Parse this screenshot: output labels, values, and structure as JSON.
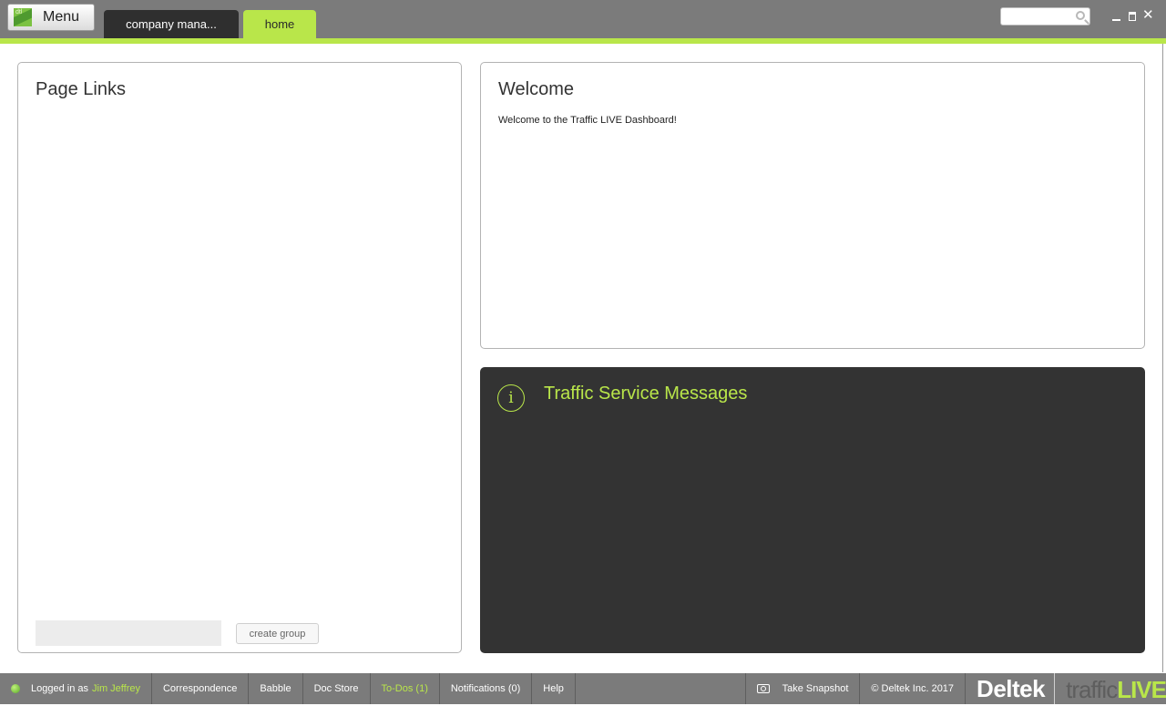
{
  "topbar": {
    "menu_logo_text": "dtl",
    "menu_label": "Menu",
    "tabs": [
      {
        "label": "company mana..."
      },
      {
        "label": "home"
      }
    ],
    "search": {
      "placeholder": ""
    }
  },
  "page_links": {
    "title": "Page Links",
    "group_input_value": "",
    "create_group_label": "create group"
  },
  "welcome": {
    "title": "Welcome",
    "text": "Welcome to the Traffic LIVE Dashboard!"
  },
  "messages": {
    "icon_glyph": "i",
    "title": "Traffic Service Messages"
  },
  "bottombar": {
    "logged_in_prefix": "Logged in as",
    "user_name": "Jim Jeffrey",
    "links": [
      "Correspondence",
      "Babble",
      "Doc Store",
      "To-Dos (1)",
      "Notifications (0)",
      "Help"
    ],
    "snapshot_label": "Take Snapshot",
    "copyright": "© Deltek Inc. 2017",
    "brand_deltek": "Deltek",
    "brand_traffic": "traffic",
    "brand_live": "LIVE"
  },
  "colors": {
    "accent": "#b9e64a",
    "bar": "#7b7b7b",
    "dark_panel": "#333333",
    "active_tab": "#2f2f2f"
  },
  "icons": [
    "menu-logo-icon",
    "search-icon",
    "minimize-icon",
    "maximize-icon",
    "close-icon",
    "info-icon",
    "status-dot-icon",
    "camera-icon"
  ]
}
